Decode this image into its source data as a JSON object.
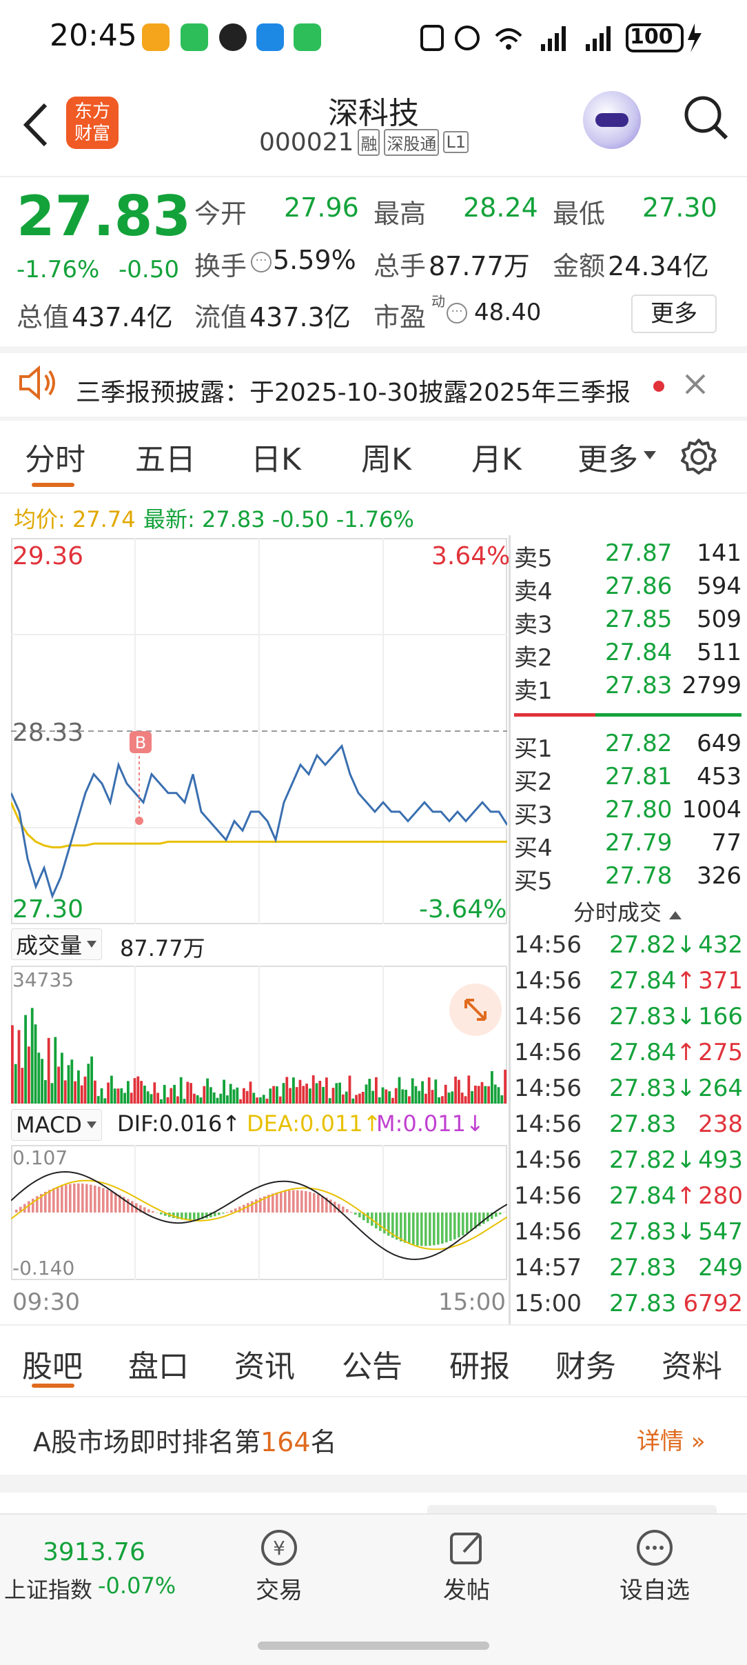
{
  "status_bar": {
    "time": "20:45",
    "battery": "100"
  },
  "header": {
    "logo_text_1": "东方",
    "logo_text_2": "财富",
    "stock_name": "深科技",
    "stock_code": "000021",
    "badge_margin": "融",
    "badge_connect": "深股通",
    "badge_level": "L1"
  },
  "quote": {
    "price": "27.83",
    "change_pct": "-1.76%",
    "change": "-0.50",
    "open_label": "今开",
    "open": "27.96",
    "high_label": "最高",
    "high": "28.24",
    "low_label": "最低",
    "low": "27.30",
    "turnover_label": "换手",
    "turnover": "5.59%",
    "volume_label": "总手",
    "volume": "87.77万",
    "amount_label": "金额",
    "amount": "24.34亿",
    "mktcap_label": "总值",
    "mktcap": "437.4亿",
    "float_label": "流值",
    "float_cap": "437.3亿",
    "pe_label": "市盈",
    "pe_sup": "动",
    "pe": "48.40",
    "more_button": "更多"
  },
  "notice": {
    "text": "三季报预披露：于2025-10-30披露2025年三季报"
  },
  "chart_tabs": [
    "分时",
    "五日",
    "日K",
    "周K",
    "月K",
    "更多"
  ],
  "info_line": {
    "avg_label": "均价: 27.74",
    "latest_label": "最新: 27.83 -0.50 -1.76%"
  },
  "chart_labels": {
    "top_price": "29.36",
    "top_pct": "3.64%",
    "mid_price": "28.33",
    "bottom_price": "27.30",
    "bottom_pct": "-3.64%",
    "marker": "B",
    "volume_label": "成交量",
    "volume_value": "87.77万",
    "volume_max": "34735",
    "macd_label": "MACD",
    "dif": "DIF:0.016",
    "dea": "DEA:0.011",
    "m": "M:0.011",
    "macd_top": "0.107",
    "macd_bottom": "-0.140",
    "time_start": "09:30",
    "time_end": "15:00"
  },
  "chart_data": {
    "type": "line",
    "x_range": [
      "09:30",
      "15:00"
    ],
    "ylim": [
      27.3,
      29.36
    ],
    "reference_price": 28.33,
    "series": [
      {
        "name": "最新",
        "values": [
          28.0,
          27.9,
          27.65,
          27.5,
          27.6,
          27.45,
          27.55,
          27.7,
          27.85,
          28.0,
          28.1,
          28.05,
          27.95,
          28.15,
          28.05,
          28.0,
          27.95,
          28.1,
          28.05,
          28.0,
          28.0,
          27.95,
          28.1,
          27.9,
          27.85,
          27.8,
          27.75,
          27.85,
          27.8,
          27.9,
          27.9,
          27.85,
          27.75,
          27.95,
          28.05,
          28.15,
          28.1,
          28.2,
          28.15,
          28.2,
          28.25,
          28.1,
          28.0,
          27.95,
          27.9,
          27.95,
          27.9,
          27.9,
          27.85,
          27.9,
          27.95,
          27.9,
          27.9,
          27.85,
          27.9,
          27.85,
          27.9,
          27.95,
          27.9,
          27.9,
          27.83
        ]
      },
      {
        "name": "均价",
        "values": [
          27.95,
          27.85,
          27.78,
          27.74,
          27.72,
          27.71,
          27.71,
          27.72,
          27.72,
          27.72,
          27.73,
          27.73,
          27.73,
          27.73,
          27.73,
          27.73,
          27.73,
          27.73,
          27.73,
          27.74,
          27.74,
          27.74,
          27.74,
          27.74,
          27.74,
          27.74,
          27.74,
          27.74,
          27.74,
          27.74,
          27.74,
          27.74,
          27.74,
          27.74,
          27.74,
          27.74,
          27.74,
          27.74,
          27.74,
          27.74,
          27.74,
          27.74,
          27.74,
          27.74,
          27.74,
          27.74,
          27.74,
          27.74,
          27.74,
          27.74,
          27.74,
          27.74,
          27.74,
          27.74,
          27.74,
          27.74,
          27.74,
          27.74,
          27.74,
          27.74,
          27.74
        ]
      }
    ]
  },
  "order_book": {
    "sell": [
      {
        "label": "卖5",
        "price": "27.87",
        "vol": "141"
      },
      {
        "label": "卖4",
        "price": "27.86",
        "vol": "594"
      },
      {
        "label": "卖3",
        "price": "27.85",
        "vol": "509"
      },
      {
        "label": "卖2",
        "price": "27.84",
        "vol": "511"
      },
      {
        "label": "卖1",
        "price": "27.83",
        "vol": "2799"
      }
    ],
    "buy": [
      {
        "label": "买1",
        "price": "27.82",
        "vol": "649"
      },
      {
        "label": "买2",
        "price": "27.81",
        "vol": "453"
      },
      {
        "label": "买3",
        "price": "27.80",
        "vol": "1004"
      },
      {
        "label": "买4",
        "price": "27.79",
        "vol": "77"
      },
      {
        "label": "买5",
        "price": "27.78",
        "vol": "326"
      }
    ]
  },
  "trades_header": "分时成交",
  "trades": [
    {
      "time": "14:56",
      "price": "27.82",
      "dir": "↓",
      "vol": "432",
      "color": "#13a23a"
    },
    {
      "time": "14:56",
      "price": "27.84",
      "dir": "↑",
      "vol": "371",
      "color": "#e1323a"
    },
    {
      "time": "14:56",
      "price": "27.83",
      "dir": "↓",
      "vol": "166",
      "color": "#13a23a"
    },
    {
      "time": "14:56",
      "price": "27.84",
      "dir": "↑",
      "vol": "275",
      "color": "#e1323a"
    },
    {
      "time": "14:56",
      "price": "27.83",
      "dir": "↓",
      "vol": "264",
      "color": "#13a23a"
    },
    {
      "time": "14:56",
      "price": "27.83",
      "dir": "",
      "vol": "238",
      "color": "#e1323a"
    },
    {
      "time": "14:56",
      "price": "27.82",
      "dir": "↓",
      "vol": "493",
      "color": "#13a23a"
    },
    {
      "time": "14:56",
      "price": "27.84",
      "dir": "↑",
      "vol": "280",
      "color": "#e1323a"
    },
    {
      "time": "14:56",
      "price": "27.83",
      "dir": "↓",
      "vol": "547",
      "color": "#13a23a"
    },
    {
      "time": "14:57",
      "price": "27.83",
      "dir": "",
      "vol": "249",
      "color": "#13a23a"
    },
    {
      "time": "15:00",
      "price": "27.83",
      "dir": "",
      "vol": "6792",
      "color": "#e1323a"
    }
  ],
  "bottom_tabs": [
    "股吧",
    "盘口",
    "资讯",
    "公告",
    "研报",
    "财务",
    "资料"
  ],
  "rank": {
    "prefix": "A股市场即时排名第",
    "number": "164",
    "suffix": "名",
    "detail": "详情"
  },
  "footer": {
    "index_value": "3913.76",
    "index_name": "上证指数",
    "index_change": "-0.07%",
    "trade": "交易",
    "post": "发帖",
    "watchlist": "设自选"
  }
}
